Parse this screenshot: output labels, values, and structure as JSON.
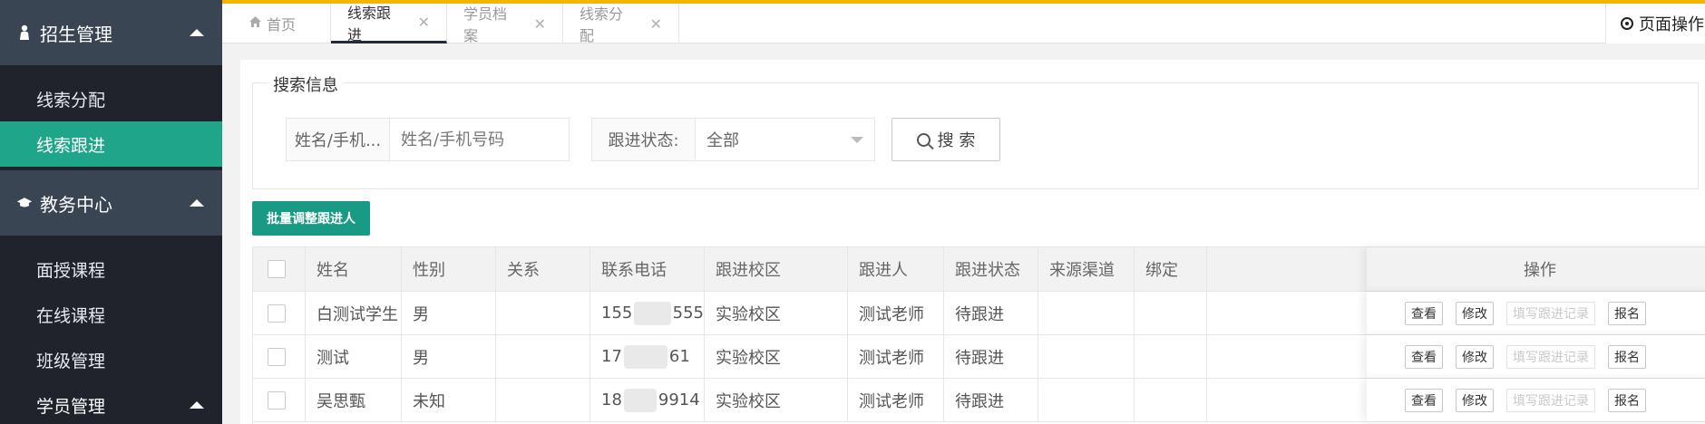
{
  "sidebar": {
    "groups": [
      {
        "title": "招生管理",
        "icon": "person-icon",
        "items": [
          "线索分配",
          "线索跟进"
        ]
      },
      {
        "title": "教务中心",
        "icon": "graduation-cap-icon",
        "items": [
          "面授课程",
          "在线课程",
          "班级管理",
          "学员管理"
        ]
      }
    ],
    "active_item": "线索跟进",
    "accent_color": "#1fa589"
  },
  "tabs": [
    {
      "label": "首页",
      "icon": "home-icon",
      "closable": false
    },
    {
      "label": "线索跟进",
      "closable": true,
      "active": true
    },
    {
      "label": "学员档案",
      "closable": true
    },
    {
      "label": "线索分配",
      "closable": true
    }
  ],
  "page_ops_label": "页面操作",
  "search": {
    "legend": "搜索信息",
    "name_label": "姓名/手机...",
    "name_placeholder": "姓名/手机号码",
    "status_label": "跟进状态:",
    "status_value": "全部",
    "button_label": "搜 索"
  },
  "batch_button": "批量调整跟进人",
  "table": {
    "headers": [
      "姓名",
      "性别",
      "关系",
      "联系电话",
      "跟进校区",
      "跟进人",
      "跟进状态",
      "来源渠道",
      "绑定",
      "操作"
    ],
    "rows": [
      {
        "name": "白测试学生",
        "gender": "男",
        "relation": "",
        "phone_a": "155",
        "phone_b": "555",
        "campus": "实验校区",
        "follower": "测试老师",
        "status": "待跟进"
      },
      {
        "name": "测试",
        "gender": "男",
        "relation": "",
        "phone_a": "17",
        "phone_b": "61",
        "campus": "实验校区",
        "follower": "测试老师",
        "status": "待跟进"
      },
      {
        "name": "吴思甄",
        "gender": "未知",
        "relation": "",
        "phone_a": "18",
        "phone_b": "9914",
        "campus": "实验校区",
        "follower": "测试老师",
        "status": "待跟进"
      }
    ],
    "ops": {
      "view": "查看",
      "edit": "修改",
      "record": "填写跟进记录",
      "enroll": "报名"
    }
  },
  "colors": {
    "top_accent": "#f5b400",
    "sidebar_bg": "#20232c",
    "sidebar_head": "#394553",
    "primary_button": "#199a85"
  }
}
